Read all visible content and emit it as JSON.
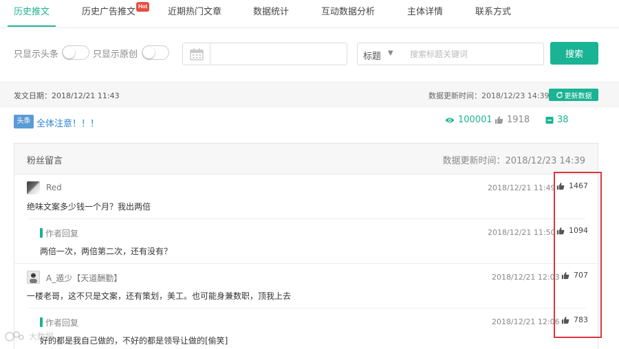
{
  "tabs": [
    {
      "label": "历史推文",
      "active": true
    },
    {
      "label": "历史广告推文",
      "badge": "Hot"
    },
    {
      "label": "近期热门文章"
    },
    {
      "label": "数据统计"
    },
    {
      "label": "互动数据分析"
    },
    {
      "label": "主体详情"
    },
    {
      "label": "联系方式"
    }
  ],
  "filter": {
    "toggle1_label": "只显示头条",
    "toggle2_label": "只显示原创",
    "date_value": "",
    "select_label": "标题",
    "search_placeholder": "搜索标题关键词",
    "search_button": "搜索"
  },
  "meta": {
    "publish_date": "发文日期：2018/12/21 11:43",
    "update_time": "数据更新时间：2018/12/23 14:39",
    "refresh_button": "更新数据"
  },
  "article": {
    "tag": "头条",
    "title": "全体注意！！！",
    "views": "100001",
    "likes": "1918",
    "comments": "38"
  },
  "comments_panel": {
    "title": "粉丝留言",
    "update_time": "数据更新时间：2018/12/23 14:39",
    "items": [
      {
        "type": "comment",
        "name": "Red",
        "time": "2018/12/21 11:49",
        "text": "绝味文案多少钱一个月？我出两倍",
        "likes": "1467"
      },
      {
        "type": "reply",
        "name": "作者回复",
        "time": "2018/12/21 11:50",
        "text": "两倍一次，两倍第二次，还有没有？",
        "likes": "1094"
      },
      {
        "type": "comment",
        "name": "A_遁少【天道酬勤】",
        "time": "2018/12/21 12:03",
        "text": "一楼老哥，这不只是文案，还有策划，美工。也可能身兼数职，顶我上去",
        "likes": "707"
      },
      {
        "type": "reply",
        "name": "作者回复",
        "time": "2018/12/21 12:06",
        "text": "好的都是我自己做的，不好的都是领导让做的[偷笑]",
        "likes": "783"
      }
    ]
  },
  "watermark": "大数据",
  "colors": {
    "accent": "#1ab394",
    "link": "#2d86d1",
    "tag_bg": "#5b9bd5",
    "hot": "#e84c3d",
    "highlight": "#d9363e"
  }
}
